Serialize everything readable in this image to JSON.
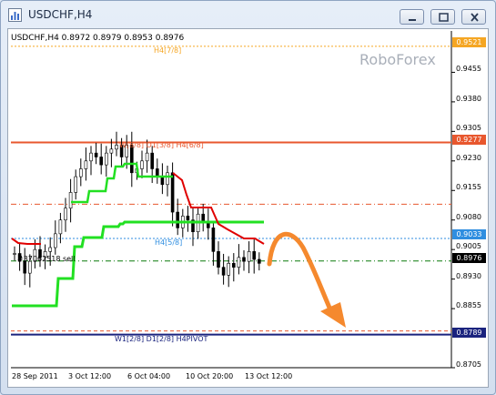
{
  "window": {
    "title": "USDCHF,H4"
  },
  "chart_info": {
    "symbol_line": "USDCHF,H4  0.8972 0.8979 0.8953 0.8976"
  },
  "watermark": "RoboForex",
  "levels": {
    "h4_7_8": "H4[7/8]",
    "w_d_h4": "W[8/8] D1[3/8] H4[6/8]",
    "h4_5_8": "H4[5/8]",
    "w_d_pivot": "W1[2/8] D1[2/8] H4PIVOT",
    "sell_label": "#37062518 sell"
  },
  "price_tags": [
    {
      "text": "0.9521",
      "color": "#f5a623",
      "price": 0.9521
    },
    {
      "text": "0.9277",
      "color": "#e8572e",
      "price": 0.9277
    },
    {
      "text": "0.9033",
      "color": "#2f8ee0",
      "price": 0.9033
    },
    {
      "text": "0.8976",
      "color": "#000000",
      "price": 0.8976
    },
    {
      "text": "0.8789",
      "color": "#1a237e",
      "price": 0.8789
    }
  ],
  "y_ticks": [
    "0.9455",
    "0.9380",
    "0.9305",
    "0.9230",
    "0.9155",
    "0.9080",
    "0.9005",
    "0.8930",
    "0.8855",
    "0.8705"
  ],
  "y_tick_values": [
    0.9455,
    0.938,
    0.9305,
    0.923,
    0.9155,
    0.908,
    0.9005,
    0.893,
    0.8855,
    0.8705
  ],
  "x_ticks": [
    "28 Sep 2011",
    "3 Oct 12:00",
    "6 Oct 04:00",
    "10 Oct 20:00",
    "13 Oct 12:00"
  ],
  "colors": {
    "green_line": "#22e022",
    "red_line": "#e00000",
    "arrow": "#f5892e",
    "pivot": "#1a237e"
  },
  "chart_data": {
    "type": "candlestick",
    "ylim": [
      0.8705,
      0.956
    ],
    "y_ticks": [
      0.9455,
      0.938,
      0.9305,
      0.923,
      0.9155,
      0.908,
      0.9005,
      0.893,
      0.8855,
      0.8705
    ],
    "x_ticks": [
      "28 Sep 2011",
      "3 Oct 12:00",
      "6 Oct 04:00",
      "10 Oct 20:00",
      "13 Oct 12:00"
    ],
    "horizontal_levels": [
      0.9521,
      0.9277,
      0.912,
      0.9033,
      0.8976,
      0.8789
    ],
    "close_series": [
      0.8995,
      0.8975,
      0.8945,
      0.8975,
      0.9005,
      0.8985,
      0.9,
      0.901,
      0.9045,
      0.908,
      0.911,
      0.915,
      0.919,
      0.921,
      0.923,
      0.925,
      0.924,
      0.922,
      0.925,
      0.926,
      0.927,
      0.924,
      0.927,
      0.92,
      0.921,
      0.923,
      0.925,
      0.921,
      0.919,
      0.917,
      0.92,
      0.91,
      0.906,
      0.909,
      0.908,
      0.905,
      0.9095,
      0.9075,
      0.906,
      0.9,
      0.896,
      0.894,
      0.897,
      0.896,
      0.8985,
      0.8975,
      0.9,
      0.898,
      0.897
    ]
  }
}
